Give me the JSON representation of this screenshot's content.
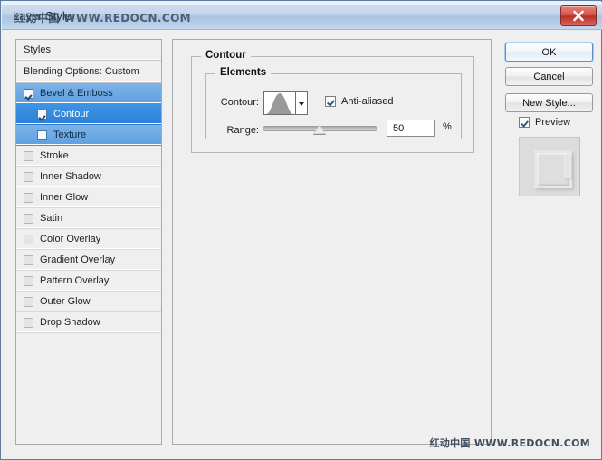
{
  "window": {
    "title": "Layer Style",
    "watermark_title": "红动中国 WWW.REDOCN.COM",
    "watermark_bottom": "红动中国 WWW.REDOCN.COM",
    "close_icon": "close-icon",
    "accent_color": "#2b81d8",
    "titlebar_color": "#aac4e2",
    "close_color": "#bc2f26"
  },
  "styles_panel": {
    "header": "Styles",
    "blending_options": "Blending Options: Custom",
    "items": [
      {
        "label": "Bevel & Emboss",
        "checked": true,
        "selected": true,
        "sub": false
      },
      {
        "label": "Contour",
        "checked": true,
        "selected": true,
        "sub": true
      },
      {
        "label": "Texture",
        "checked": false,
        "selected": true,
        "sub": true
      },
      {
        "label": "Stroke",
        "checked": false,
        "selected": false,
        "sub": false
      },
      {
        "label": "Inner Shadow",
        "checked": false,
        "selected": false,
        "sub": false
      },
      {
        "label": "Inner Glow",
        "checked": false,
        "selected": false,
        "sub": false
      },
      {
        "label": "Satin",
        "checked": false,
        "selected": false,
        "sub": false
      },
      {
        "label": "Color Overlay",
        "checked": false,
        "selected": false,
        "sub": false
      },
      {
        "label": "Gradient Overlay",
        "checked": false,
        "selected": false,
        "sub": false
      },
      {
        "label": "Pattern Overlay",
        "checked": false,
        "selected": false,
        "sub": false
      },
      {
        "label": "Outer Glow",
        "checked": false,
        "selected": false,
        "sub": false
      },
      {
        "label": "Drop Shadow",
        "checked": false,
        "selected": false,
        "sub": false
      }
    ]
  },
  "main": {
    "group_title": "Contour",
    "elements_title": "Elements",
    "contour_label": "Contour:",
    "contour_preset": "cone-contour",
    "contour_dropdown_icon": "chevron-down-icon",
    "anti_aliased_label": "Anti-aliased",
    "anti_aliased_checked": true,
    "range_label": "Range:",
    "range_value": "50",
    "range_unit": "%"
  },
  "buttons": {
    "ok": "OK",
    "cancel": "Cancel",
    "new_style": "New Style...",
    "preview_label": "Preview",
    "preview_checked": true
  }
}
